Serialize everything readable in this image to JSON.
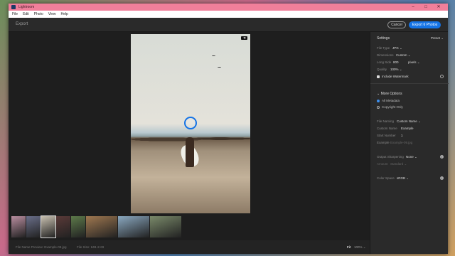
{
  "window": {
    "title": "Lightroom",
    "controls": [
      "–",
      "□",
      "✕"
    ]
  },
  "menu": [
    "File",
    "Edit",
    "Photo",
    "View",
    "Help"
  ],
  "toolbar": {
    "section_label": "Export",
    "cancel_label": "Cancel",
    "export_label": "Export 6 Photos"
  },
  "photo": {
    "badge": "↑▣",
    "selected_index": 2
  },
  "filmstrip": {
    "thumbs": [
      {
        "color": "#b98ea0",
        "icon": "flowers-thumb"
      },
      {
        "color": "#6a6f8a",
        "icon": "abstract-thumb"
      },
      {
        "color": "#c8c0b0",
        "icon": "beach-surfer-thumb"
      },
      {
        "color": "#5a3a38",
        "icon": "dark-portrait-thumb"
      },
      {
        "color": "#5d7a4a",
        "icon": "outdoor-thumb"
      },
      {
        "color": "#a07850",
        "icon": "desk-thumb"
      },
      {
        "color": "#8aa8c0",
        "icon": "person-thumb"
      },
      {
        "color": "#7a8a6a",
        "icon": "camera-thumb"
      }
    ]
  },
  "status": {
    "file_name_preview": "File Name Preview: Example-09.jpg",
    "file_size": "File Size: 648.4 KB",
    "fit": "Fit",
    "zoom": "100% ⌄"
  },
  "settings": {
    "header": "Settings",
    "preset": "Preset ⌄",
    "file_type_label": "File Type",
    "file_type_value": "JPG ⌄",
    "dimensions_label": "Dimensions",
    "dimensions_value": "Custom ⌄",
    "long_side_label": "Long Side",
    "long_side_value": "800",
    "long_side_unit": "pixels ⌄",
    "quality_label": "Quality",
    "quality_value": "100% ⌄",
    "watermark_label": "Include Watermark",
    "watermark_checked": true
  },
  "more_options": {
    "header": "More Options",
    "all_metadata": "All Metadata",
    "copyright_only": "Copyright Only",
    "metadata_selected": "all"
  },
  "naming": {
    "file_naming_label": "File Naming",
    "file_naming_value": "Custom Name ⌄",
    "custom_name_label": "Custom Name",
    "custom_name_value": "Example",
    "start_number_label": "Start Number",
    "start_number_value": "1",
    "example_label": "Example",
    "example_value": "Example-09.jpg"
  },
  "output": {
    "sharpening_label": "Output Sharpening",
    "sharpening_value": "None ⌄",
    "amount_label": "Amount",
    "amount_value": "Standard ⌄",
    "color_space_label": "Color Space",
    "color_space_value": "sRGB ⌄"
  },
  "colors": {
    "accent": "#1473e6",
    "titlebar": "#f07f9a"
  }
}
